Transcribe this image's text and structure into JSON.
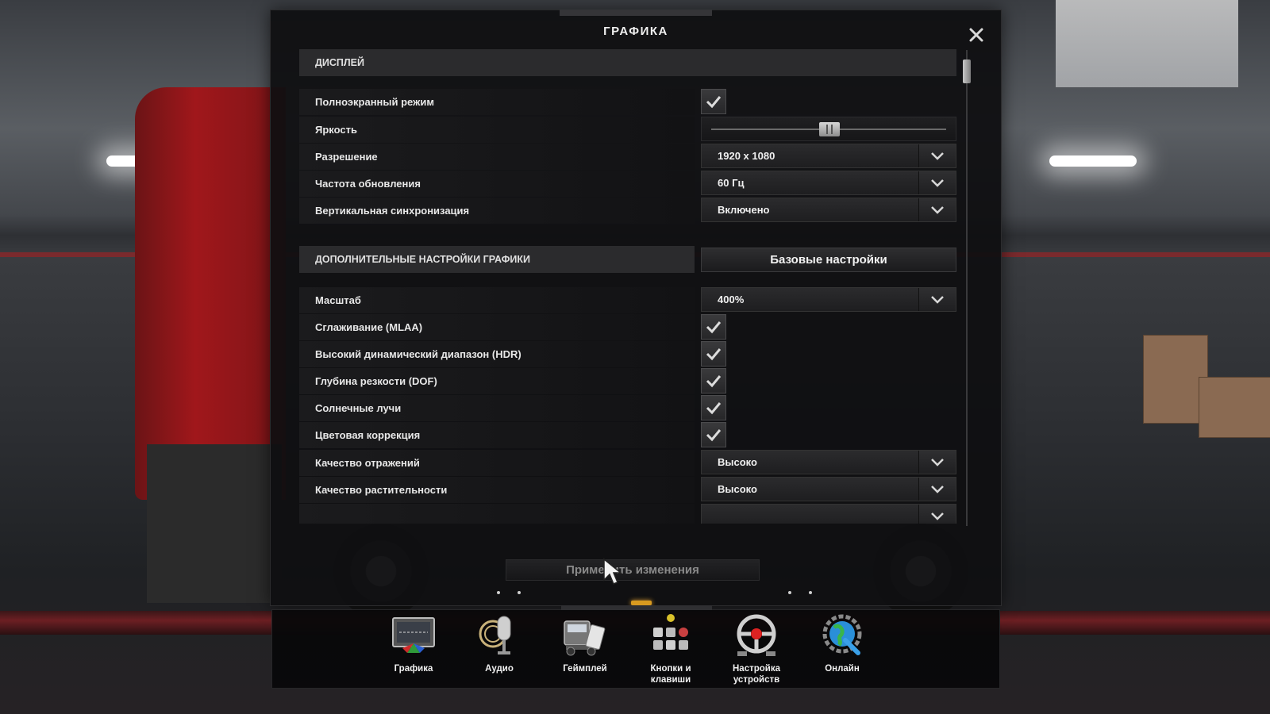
{
  "dialog": {
    "title": "ГРАФИКА",
    "close_label": "✕"
  },
  "sections": {
    "display": "ДИСПЛЕЙ",
    "advanced": "ДОПОЛНИТЕЛЬНЫЕ НАСТРОЙКИ ГРАФИКИ",
    "preset_button": "Базовые настройки"
  },
  "display_rows": {
    "fullscreen": {
      "label": "Полноэкранный режим",
      "checked": true
    },
    "brightness": {
      "label": "Яркость",
      "value": 0.5
    },
    "resolution": {
      "label": "Разрешение",
      "value": "1920 x 1080"
    },
    "refresh": {
      "label": "Частота обновления",
      "value": "60 Гц"
    },
    "vsync": {
      "label": "Вертикальная синхронизация",
      "value": "Включено"
    }
  },
  "advanced_rows": {
    "scale": {
      "label": "Масштаб",
      "value": "400%"
    },
    "mlaa": {
      "label": "Сглаживание (MLAA)",
      "checked": true
    },
    "hdr": {
      "label": "Высокий динамический диапазон (HDR)",
      "checked": true
    },
    "dof": {
      "label": "Глубина резкости (DOF)",
      "checked": true
    },
    "sunrays": {
      "label": "Солнечные лучи",
      "checked": true
    },
    "color": {
      "label": "Цветовая коррекция",
      "checked": true
    },
    "reflections": {
      "label": "Качество отражений",
      "value": "Высоко"
    },
    "vegetation": {
      "label": "Качество растительности",
      "value": "Высоко"
    }
  },
  "apply_button": "Применить изменения",
  "tabs": {
    "graphics": "Графика",
    "audio": "Аудио",
    "gameplay": "Геймплей",
    "keys_line1": "Кнопки и",
    "keys_line2": "клавиши",
    "devices_line1": "Настройка",
    "devices_line2": "устройств",
    "online": "Онлайн"
  },
  "colors": {
    "accent_amber": "#d89a20",
    "truck_red": "#a0171b"
  }
}
